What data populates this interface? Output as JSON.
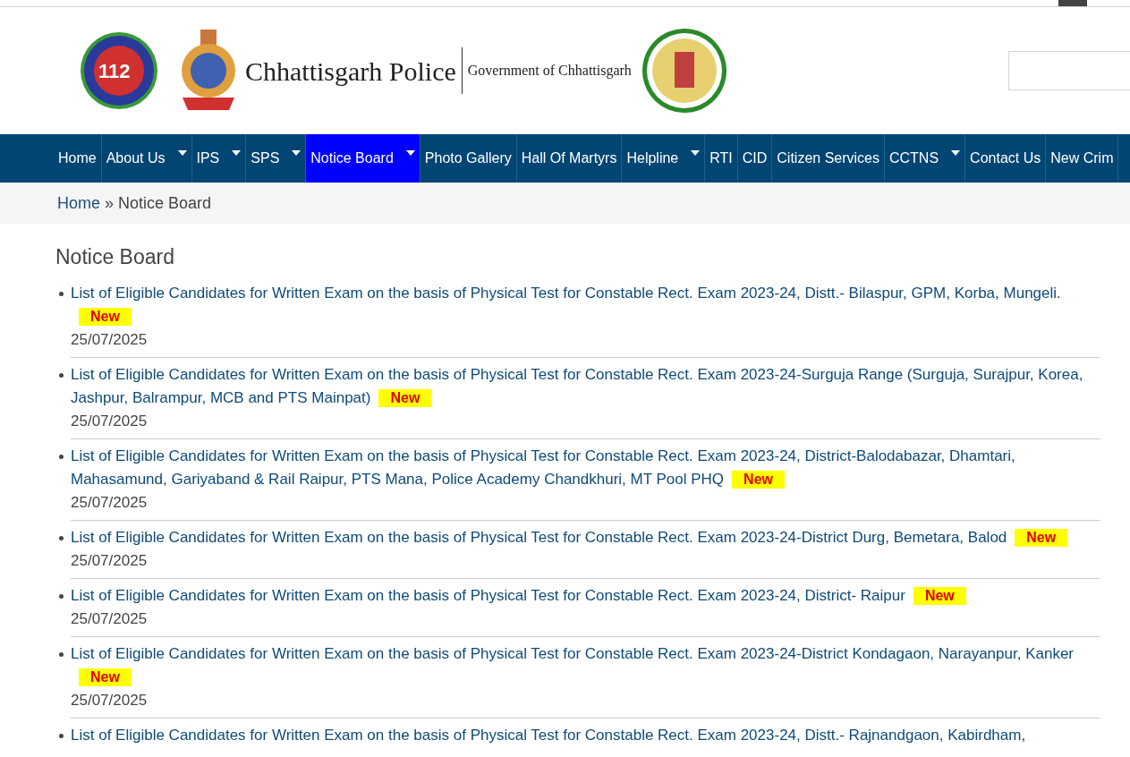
{
  "header": {
    "emergency_logo": {
      "text": "112"
    },
    "police_title": "Chhattisgarh Police",
    "government_title": "Government of Chhattisgarh"
  },
  "nav": [
    {
      "label": "Home",
      "dropdown": false,
      "selected": false
    },
    {
      "label": "About Us",
      "dropdown": true,
      "selected": false
    },
    {
      "label": "IPS",
      "dropdown": true,
      "selected": false
    },
    {
      "label": "SPS",
      "dropdown": true,
      "selected": false
    },
    {
      "label": "Notice Board",
      "dropdown": true,
      "selected": true
    },
    {
      "label": "Photo Gallery",
      "dropdown": false,
      "selected": false
    },
    {
      "label": "Hall Of Martyrs",
      "dropdown": false,
      "selected": false
    },
    {
      "label": "Helpline",
      "dropdown": true,
      "selected": false
    },
    {
      "label": "RTI",
      "dropdown": false,
      "selected": false
    },
    {
      "label": "CID",
      "dropdown": false,
      "selected": false
    },
    {
      "label": "Citizen Services",
      "dropdown": false,
      "selected": false
    },
    {
      "label": "CCTNS",
      "dropdown": true,
      "selected": false
    },
    {
      "label": "Contact Us",
      "dropdown": false,
      "selected": false
    },
    {
      "label": "New Crim",
      "dropdown": false,
      "selected": false
    }
  ],
  "breadcrumb": {
    "link": "Home",
    "separator": "»",
    "current": "Notice Board"
  },
  "page_title": "Notice Board",
  "notices": [
    {
      "title": "List of Eligible Candidates for Written Exam on the basis of Physical Test for Constable Rect. Exam 2023-24, Distt.- Bilaspur, GPM, Korba, Mungeli.",
      "badge": "New",
      "date": "25/07/2025"
    },
    {
      "title": "List of Eligible Candidates for Written Exam on the basis of Physical Test for Constable Rect. Exam 2023-24-Surguja Range (Surguja, Surajpur, Korea, Jashpur, Balrampur, MCB and PTS Mainpat)",
      "badge": "New",
      "date": "25/07/2025"
    },
    {
      "title": "List of Eligible Candidates for Written Exam on the basis of Physical Test for Constable Rect. Exam 2023-24, District-Balodabazar, Dhamtari, Mahasamund, Gariyaband & Rail Raipur, PTS Mana, Police Academy Chandkhuri, MT Pool PHQ",
      "badge": "New",
      "date": "25/07/2025"
    },
    {
      "title": "List of Eligible Candidates for Written Exam on the basis of Physical Test for Constable Rect. Exam 2023-24-District Durg, Bemetara, Balod",
      "badge": "New",
      "date": "25/07/2025"
    },
    {
      "title": "List of Eligible Candidates for Written Exam on the basis of Physical Test for Constable Rect. Exam 2023-24, District- Raipur",
      "badge": "New",
      "date": "25/07/2025"
    },
    {
      "title": "List of Eligible Candidates for Written Exam on the basis of Physical Test for Constable Rect. Exam 2023-24-District Kondagaon, Narayanpur, Kanker",
      "badge": "New",
      "date": "25/07/2025"
    },
    {
      "title": "List of Eligible Candidates for Written Exam on the basis of Physical Test for Constable Rect. Exam 2023-24, Distt.- Rajnandgaon, Kabirdham,"
    }
  ]
}
